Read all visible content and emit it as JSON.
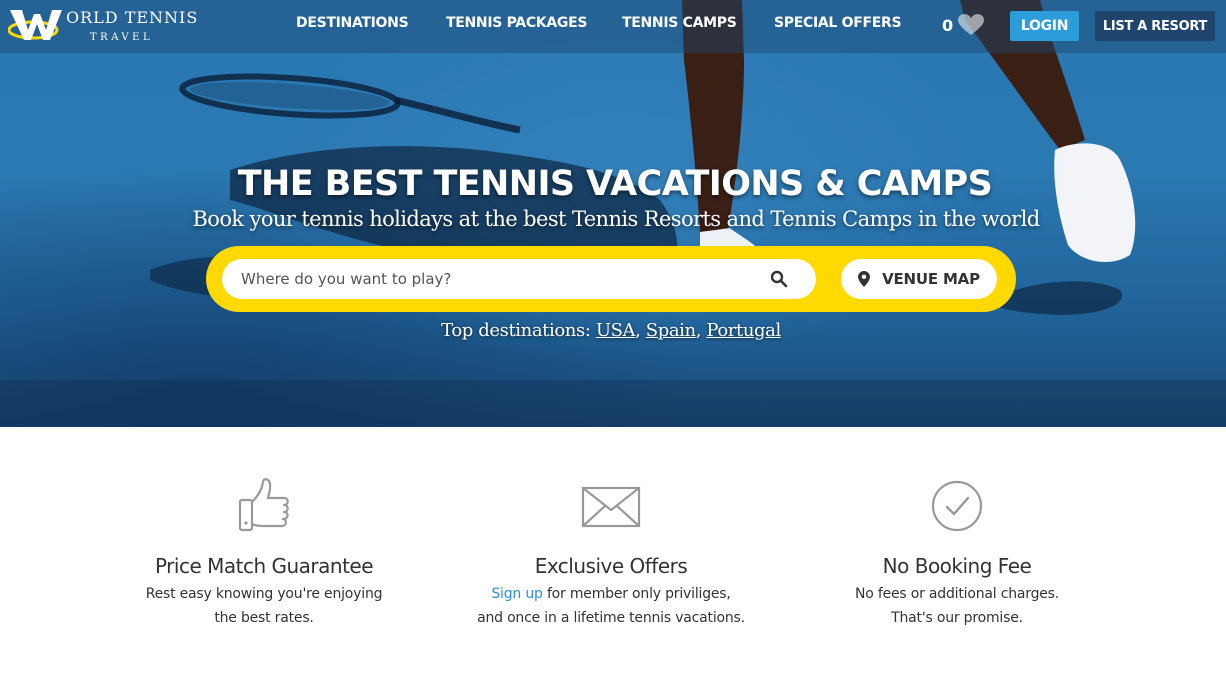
{
  "brand": {
    "logo_line1": "ORLD TENNIS",
    "logo_line2": "TRAVEL",
    "accent_color": "#ffd900",
    "link_color": "#2d8fd5"
  },
  "nav": {
    "items": [
      {
        "label": "DESTINATIONS"
      },
      {
        "label": "TENNIS PACKAGES"
      },
      {
        "label": "TENNIS CAMPS"
      },
      {
        "label": "SPECIAL OFFERS"
      }
    ],
    "favorites_count": "0",
    "favorites_icon": "heart-icon",
    "login_label": "LOGIN",
    "list_resort_label": "LIST A RESORT"
  },
  "hero": {
    "title": "THE BEST TENNIS VACATIONS & CAMPS",
    "subtitle": "Book your tennis holidays at the best Tennis Resorts and Tennis Camps in the world",
    "search_placeholder": "Where do you want to play?",
    "search_value": "",
    "search_icon": "search-icon",
    "venue_map_label": "VENUE MAP",
    "venue_map_icon": "map-pin-icon",
    "top_destinations_label": "Top destinations:",
    "top_destinations": [
      "USA",
      "Spain",
      "Portugal"
    ]
  },
  "features": [
    {
      "icon": "thumbs-up-icon",
      "title": "Price Match Guarantee",
      "line1": "Rest easy knowing you're enjoying",
      "line2": "the best rates."
    },
    {
      "icon": "envelope-icon",
      "title": "Exclusive Offers",
      "link": "Sign up",
      "line1_rest": " for member only priviliges,",
      "line2": "and once in a lifetime tennis vacations."
    },
    {
      "icon": "checkmark-circle-icon",
      "title": "No Booking Fee",
      "line1": "No fees or additional charges.",
      "line2": "That's our promise."
    }
  ]
}
